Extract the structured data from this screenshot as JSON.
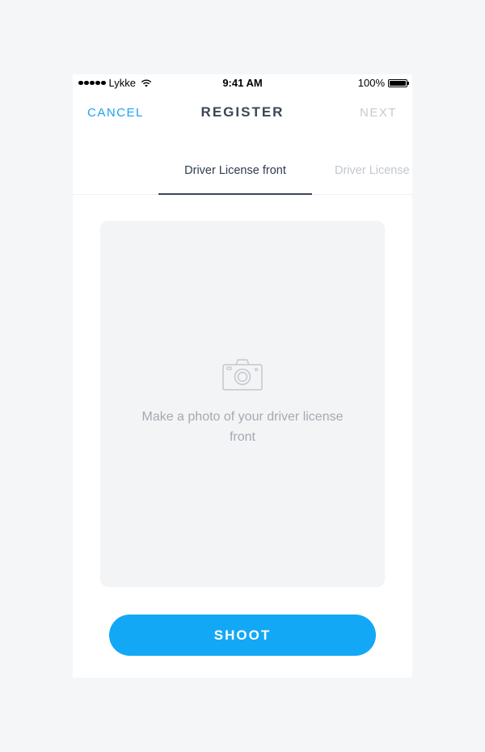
{
  "status_bar": {
    "carrier": "Lykke",
    "time": "9:41 AM",
    "battery_text": "100%",
    "battery_level": 1.0
  },
  "nav": {
    "cancel_label": "CANCEL",
    "title": "REGISTER",
    "next_label": "NEXT"
  },
  "tabs": [
    {
      "label": "Driver License front",
      "active": true
    },
    {
      "label": "Driver License back",
      "active": false
    }
  ],
  "photo": {
    "icon": "camera-icon",
    "hint": "Make a photo of your driver license front"
  },
  "actions": {
    "shoot_label": "SHOOT"
  },
  "colors": {
    "accent": "#13a8f6",
    "title_text": "#3b4656",
    "disabled_text": "#c6cad0",
    "hint_text": "#a4aab2",
    "photo_bg": "#f3f4f6",
    "page_bg": "#f5f6f8"
  }
}
